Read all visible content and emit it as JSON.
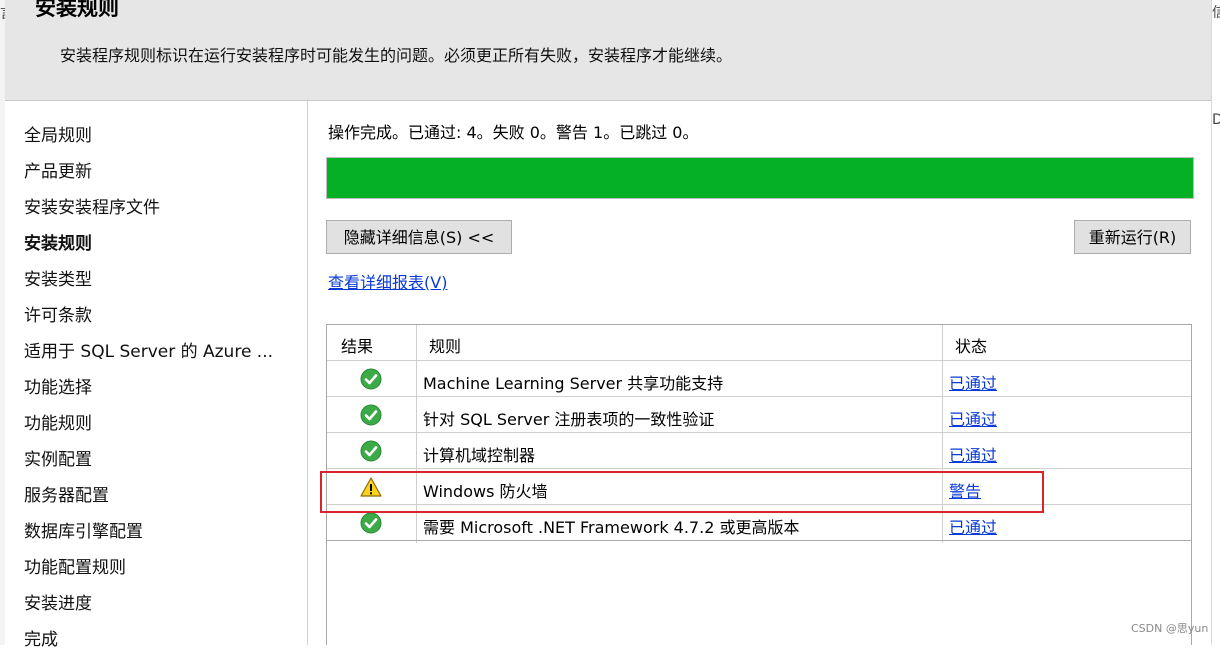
{
  "header": {
    "title": "安装规则",
    "description": "安装程序规则标识在运行安装程序时可能发生的问题。必须更正所有失败，安装程序才能继续。"
  },
  "sidebar": {
    "items": [
      {
        "label": "全局规则"
      },
      {
        "label": "产品更新"
      },
      {
        "label": "安装安装程序文件"
      },
      {
        "label": "安装规则",
        "active": true
      },
      {
        "label": "安装类型"
      },
      {
        "label": "许可条款"
      },
      {
        "label": "适用于 SQL Server 的 Azure ..."
      },
      {
        "label": "功能选择"
      },
      {
        "label": "功能规则"
      },
      {
        "label": "实例配置"
      },
      {
        "label": "服务器配置"
      },
      {
        "label": "数据库引擎配置"
      },
      {
        "label": "功能配置规则"
      },
      {
        "label": "安装进度"
      },
      {
        "label": "完成"
      }
    ]
  },
  "main": {
    "status_text": "操作完成。已通过: 4。失败 0。警告 1。已跳过 0。",
    "progress_fraction": 1.0,
    "progress_color": "#06b025",
    "hide_details_label": "隐藏详细信息(S) <<",
    "rerun_label": "重新运行(R)",
    "report_link": "查看详细报表(V)",
    "table": {
      "headers": [
        "结果",
        "规则",
        "状态"
      ],
      "rows": [
        {
          "icon": "check-icon",
          "rule": "Machine Learning Server 共享功能支持",
          "status": "已通过"
        },
        {
          "icon": "check-icon",
          "rule": "针对 SQL Server 注册表项的一致性验证",
          "status": "已通过"
        },
        {
          "icon": "check-icon",
          "rule": "计算机域控制器",
          "status": "已通过"
        },
        {
          "icon": "warning-icon",
          "rule": "Windows 防火墙",
          "status": "警告"
        },
        {
          "icon": "check-icon",
          "rule": "需要 Microsoft .NET Framework 4.7.2 或更高版本",
          "status": "已通过"
        }
      ]
    }
  },
  "edge": {
    "left_char": "言",
    "right_top": "信",
    "right_mid": "D"
  },
  "watermark": "CSDN @思yun",
  "colors": {
    "highlight": "#d9232d",
    "link": "#0a3ad6"
  }
}
